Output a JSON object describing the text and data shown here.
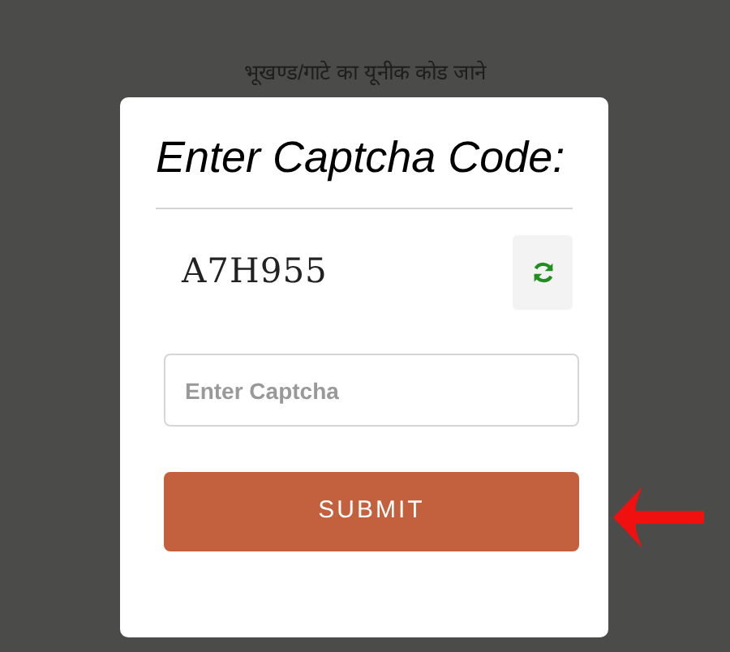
{
  "background_text": "भूखण्ड/गाटे का यूनीक कोड जाने",
  "dialog": {
    "title": "Enter Captcha Code:",
    "captcha_code": "A7H955",
    "captcha_field": {
      "placeholder": "Enter Captcha"
    },
    "submit_button": "SUBMIT"
  }
}
